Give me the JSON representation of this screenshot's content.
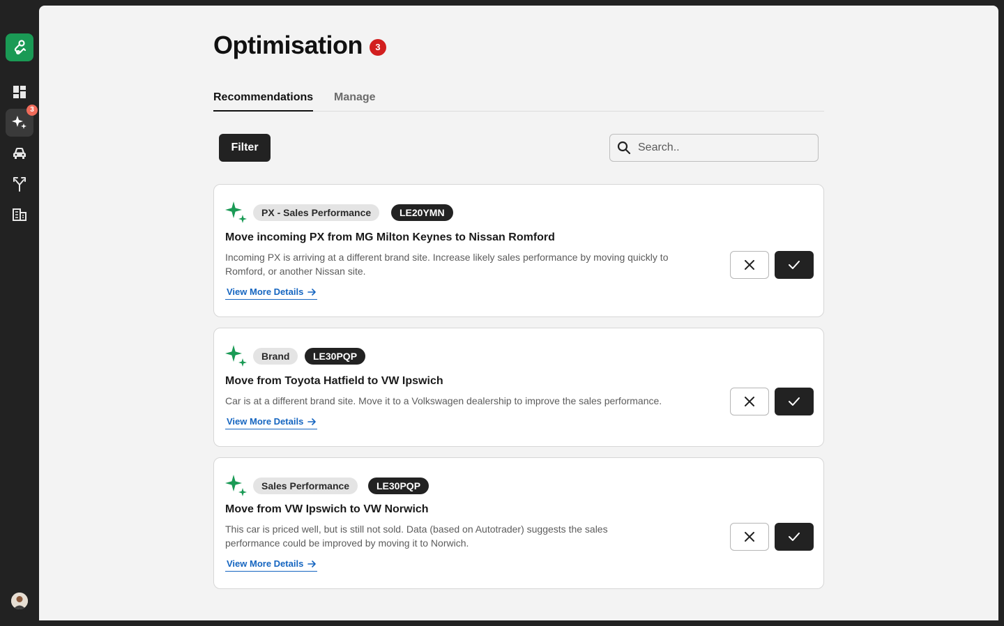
{
  "sidebar": {
    "items": [
      {
        "name": "dashboard-icon"
      },
      {
        "name": "sparkle-icon",
        "badge": "3"
      },
      {
        "name": "car-icon"
      },
      {
        "name": "merge-icon"
      },
      {
        "name": "building-icon"
      }
    ]
  },
  "header": {
    "title": "Optimisation",
    "badge": "3"
  },
  "tabs": [
    {
      "label": "Recommendations",
      "active": true
    },
    {
      "label": "Manage",
      "active": false
    }
  ],
  "toolbar": {
    "filter_label": "Filter",
    "search_placeholder": "Search.."
  },
  "recommendations": [
    {
      "tag": "PX - Sales Performance",
      "plate": "LE20YMN",
      "title": "Move incoming PX from MG Milton Keynes to Nissan Romford",
      "description": "Incoming PX is arriving at a different brand site. Increase likely sales performance by moving quickly to Romford, or another Nissan site.",
      "link": "View More Details"
    },
    {
      "tag": "Brand",
      "plate": "LE30PQP",
      "title": "Move from Toyota Hatfield to VW Ipswich",
      "description": "Car is at a different brand site. Move it to a Volkswagen dealership to improve the sales performance.",
      "link": "View More Details"
    },
    {
      "tag": "Sales Performance",
      "plate": "LE30PQP",
      "title": "Move from VW Ipswich  to VW Norwich",
      "description": "This car is priced well, but is still not sold.  Data (based on Autotrader) suggests the sales performance could be improved by moving it to Norwich.",
      "link": "View More Details"
    }
  ],
  "colors": {
    "brand": "#1a9a55",
    "accent_dark": "#222222",
    "link": "#1565c0",
    "badge_red": "#d21f1f"
  }
}
